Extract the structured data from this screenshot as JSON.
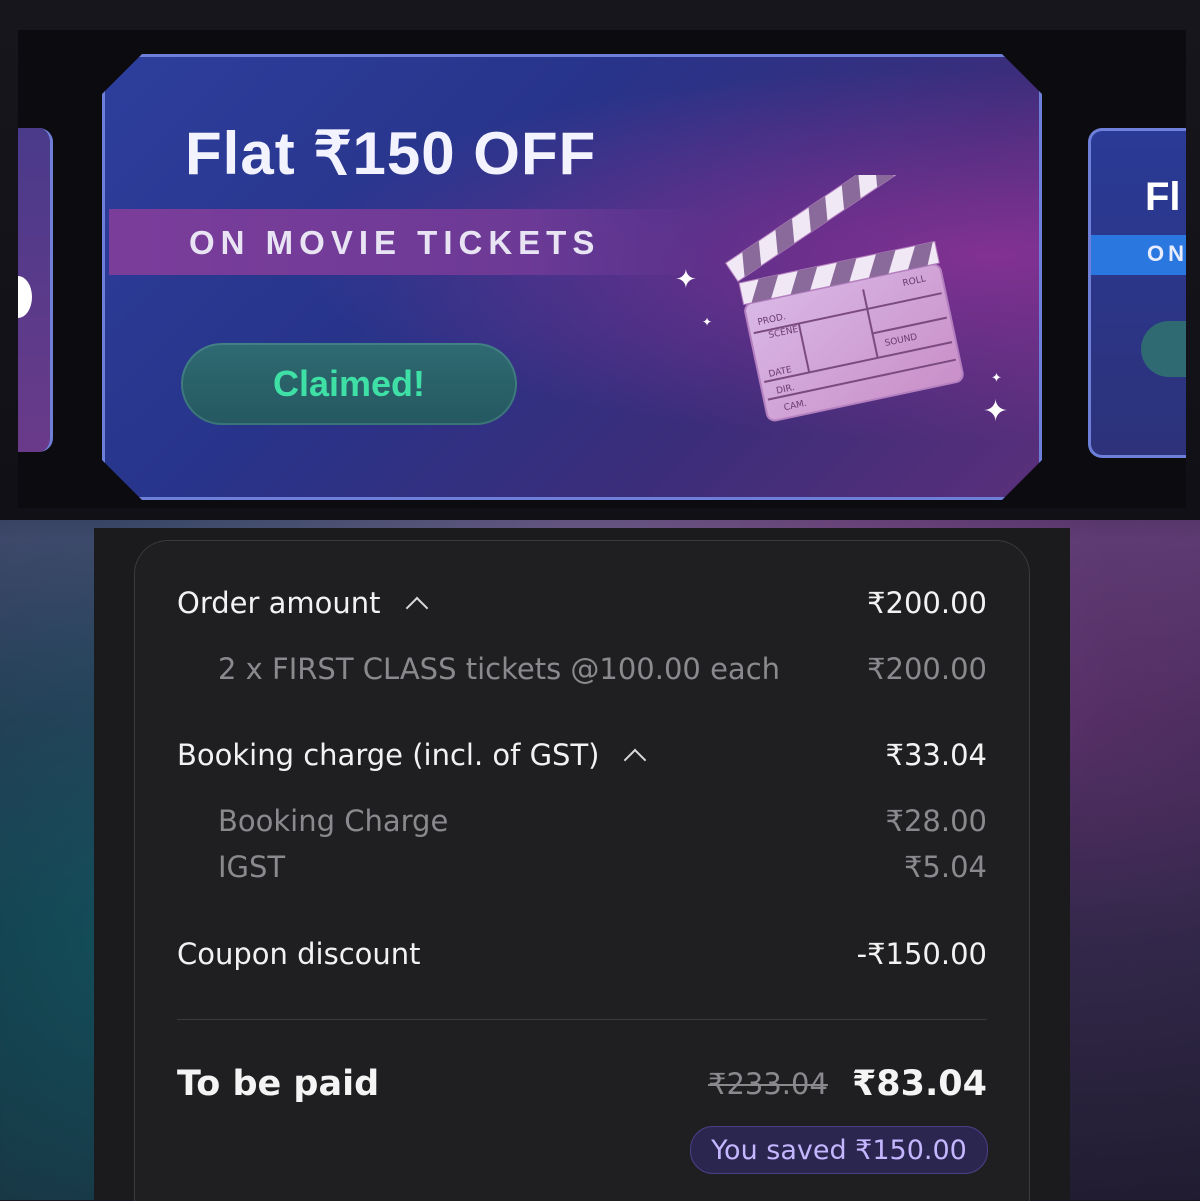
{
  "banner": {
    "title": "Flat ₹150 OFF",
    "subtitle": "ON MOVIE TICKETS",
    "button": "Claimed!",
    "clapper_labels": {
      "prod": "PROD.",
      "scene": "SCENE",
      "roll": "ROLL",
      "sound": "SOUND",
      "date": "DATE",
      "dir": "DIR.",
      "cam": "CAM."
    },
    "next_card_title": "Fl",
    "next_card_sub": "ON"
  },
  "summary": {
    "order_amount": {
      "label": "Order amount",
      "value": "₹200.00"
    },
    "order_item": {
      "label": "2 x FIRST CLASS tickets @100.00 each",
      "value": "₹200.00"
    },
    "booking_charge": {
      "label": "Booking charge (incl. of GST)",
      "value": "₹33.04"
    },
    "booking_items": [
      {
        "label": "Booking Charge",
        "value": "₹28.00"
      },
      {
        "label": "IGST",
        "value": "₹5.04"
      }
    ],
    "coupon": {
      "label": "Coupon discount",
      "value": "-₹150.00"
    },
    "total": {
      "label": "To be paid",
      "original": "₹233.04",
      "value": "₹83.04"
    },
    "saved": "You saved ₹150.00"
  }
}
